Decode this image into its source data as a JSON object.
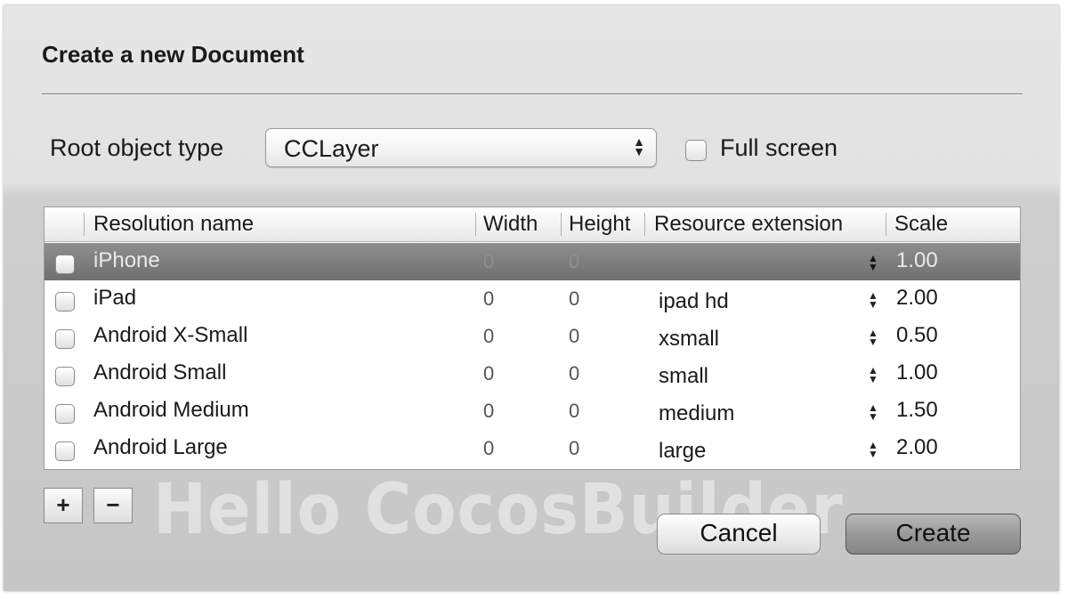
{
  "dialog": {
    "title": "Create a new Document"
  },
  "root": {
    "label": "Root object type",
    "value": "CCLayer",
    "fullscreen_label": "Full screen",
    "fullscreen_checked": false
  },
  "table": {
    "headers": [
      "Resolution name",
      "Width",
      "Height",
      "Resource extension",
      "Scale"
    ],
    "rows": [
      {
        "name": "iPhone",
        "width": "0",
        "height": "0",
        "ext": "",
        "scale": "1.00",
        "checked": false,
        "selected": true
      },
      {
        "name": "iPad",
        "width": "0",
        "height": "0",
        "ext": "ipad hd",
        "scale": "2.00",
        "checked": false,
        "selected": false
      },
      {
        "name": "Android X-Small",
        "width": "0",
        "height": "0",
        "ext": "xsmall",
        "scale": "0.50",
        "checked": false,
        "selected": false
      },
      {
        "name": "Android Small",
        "width": "0",
        "height": "0",
        "ext": "small",
        "scale": "1.00",
        "checked": false,
        "selected": false
      },
      {
        "name": "Android Medium",
        "width": "0",
        "height": "0",
        "ext": "medium",
        "scale": "1.50",
        "checked": false,
        "selected": false
      },
      {
        "name": "Android Large",
        "width": "0",
        "height": "0",
        "ext": "large",
        "scale": "2.00",
        "checked": false,
        "selected": false
      }
    ]
  },
  "controls": {
    "add": "+",
    "remove": "−"
  },
  "watermark": "Hello CocosBuilder",
  "buttons": {
    "cancel": "Cancel",
    "create": "Create"
  },
  "icons": {
    "select": "updown-arrows-icon",
    "stepper": "stepper-arrows-icon"
  }
}
